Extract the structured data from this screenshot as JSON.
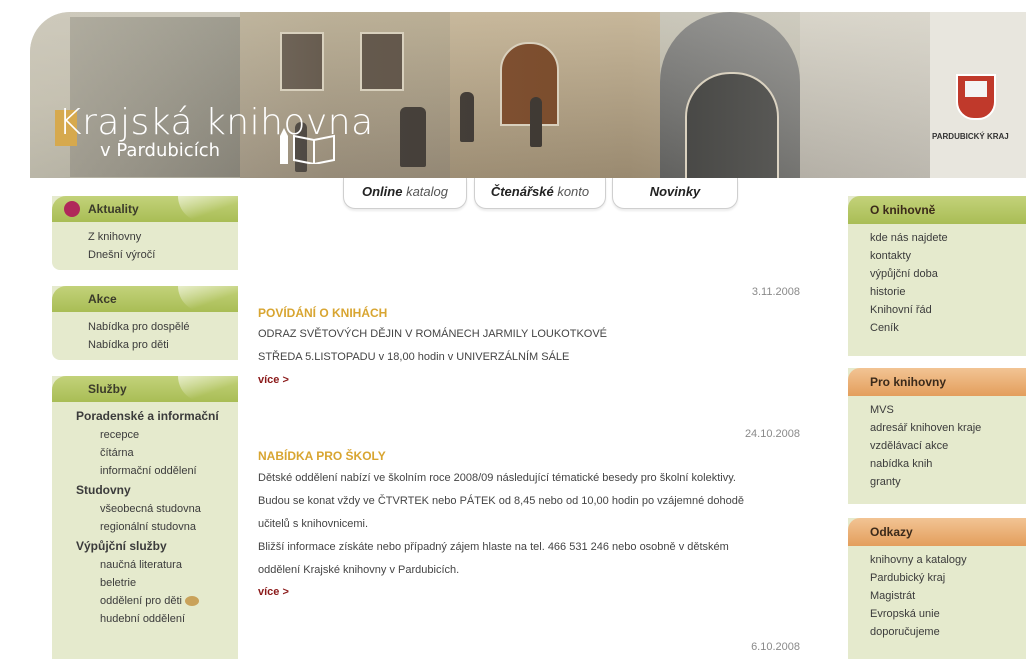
{
  "header": {
    "logo_initial": "K",
    "logo_rest": "rajská knihovna",
    "logo_sub": "v Pardubicích",
    "crest_label": "PARDUBICKÝ KRAJ"
  },
  "tabs": [
    {
      "bold": "Online",
      "rest": " katalog"
    },
    {
      "bold": "Čtenářské",
      "rest": " konto"
    },
    {
      "bold": "Novinky",
      "rest": ""
    }
  ],
  "left": {
    "aktuality": {
      "title": "Aktuality",
      "items": [
        "Z knihovny",
        "Dnešní výročí"
      ]
    },
    "akce": {
      "title": "Akce",
      "items": [
        "Nabídka pro dospělé",
        "Nabídka pro děti"
      ]
    },
    "sluzby": {
      "title": "Služby",
      "groups": [
        {
          "label": "Poradenské a informační",
          "items": [
            "recepce",
            "čítárna",
            "informační oddělení"
          ]
        },
        {
          "label": "Studovny",
          "items": [
            "všeobecná studovna",
            "regionální studovna"
          ]
        },
        {
          "label": "Výpůjční služby",
          "items": [
            "naučná literatura",
            "beletrie",
            "oddělení pro děti",
            "hudební oddělení"
          ]
        }
      ]
    }
  },
  "news": [
    {
      "date": "3.11.2008",
      "title": "POVÍDÁNÍ O KNIHÁCH",
      "lines": [
        "ODRAZ SVĚTOVÝCH DĚJIN V ROMÁNECH JARMILY LOUKOTKOVÉ",
        "STŘEDA 5.LISTOPADU v 18,00 hodin v UNIVERZÁLNÍM SÁLE"
      ],
      "more": "více >"
    },
    {
      "date": "24.10.2008",
      "title": "NABÍDKA PRO ŠKOLY",
      "lines": [
        "Dětské oddělení nabízí ve školním roce 2008/09 následující tématické besedy pro školní kolektivy.",
        "Budou se konat vždy ve ČTVRTEK nebo PÁTEK od 8,45 nebo od 10,00 hodin po vzájemné dohodě",
        "učitelů s knihovnicemi.",
        "Bližší informace získáte nebo případný zájem hlaste na tel. 466 531 246 nebo osobně v dětském",
        "oddělení Krajské knihovny v Pardubicích."
      ],
      "more": "více >"
    },
    {
      "date": "6.10.2008"
    }
  ],
  "right": {
    "oknihovne": {
      "title": "O knihovně",
      "items": [
        "kde nás najdete",
        "kontakty",
        "výpůjční doba",
        "historie",
        "Knihovní řád",
        "Ceník"
      ]
    },
    "proknihovny": {
      "title": "Pro knihovny",
      "items": [
        "MVS",
        "adresář knihoven kraje",
        "vzdělávací akce",
        "nabídka knih",
        "granty"
      ]
    },
    "odkazy": {
      "title": "Odkazy",
      "items": [
        "knihovny a katalogy",
        "Pardubický kraj",
        "Magistrát",
        "Evropská unie",
        "doporučujeme"
      ]
    }
  }
}
